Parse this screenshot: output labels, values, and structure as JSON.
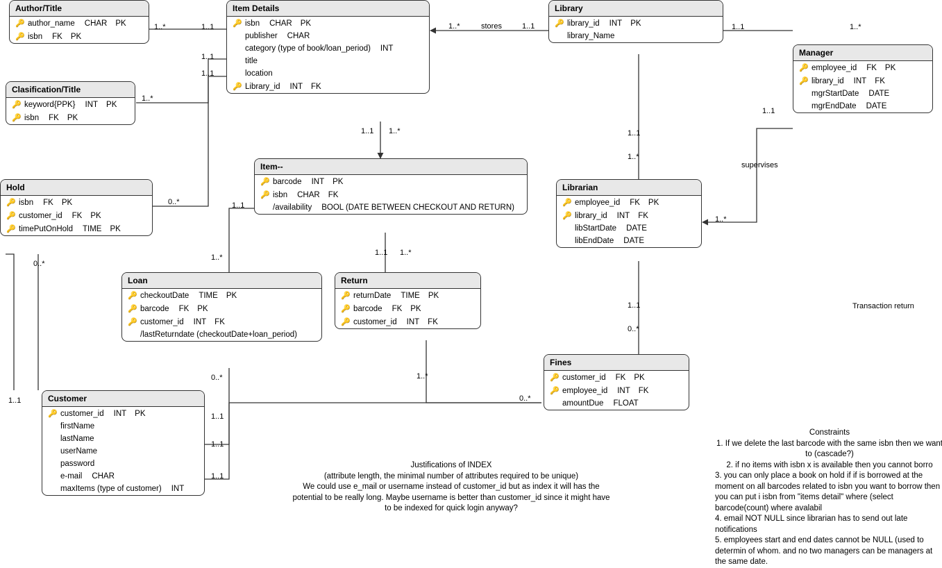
{
  "entities": {
    "authorTitle": {
      "title": "Author/Title",
      "rows": [
        {
          "key": "yellow",
          "name": "author_name",
          "type": "CHAR",
          "keys": "PK"
        },
        {
          "key": "yellow",
          "name": "isbn",
          "type": "FK",
          "keys": "PK"
        }
      ]
    },
    "classificationTitle": {
      "title": "Clasification/Title",
      "rows": [
        {
          "key": "yellow",
          "name": "keyword{PPK}",
          "type": "INT",
          "keys": "PK"
        },
        {
          "key": "yellow",
          "name": "isbn",
          "type": "FK",
          "keys": "PK"
        }
      ]
    },
    "itemDetails": {
      "title": "Item Details",
      "rows": [
        {
          "key": "yellow",
          "name": "isbn",
          "type": "CHAR",
          "keys": "PK"
        },
        {
          "key": "none",
          "name": "publisher",
          "type": "CHAR",
          "keys": ""
        },
        {
          "key": "none",
          "name": "category (type of book/loan_period)",
          "type": "INT",
          "keys": ""
        },
        {
          "key": "none",
          "name": "title",
          "type": "",
          "keys": ""
        },
        {
          "key": "none",
          "name": "location",
          "type": "",
          "keys": ""
        },
        {
          "key": "gray",
          "name": "Library_id",
          "type": "INT",
          "keys": "FK"
        }
      ]
    },
    "library": {
      "title": "Library",
      "rows": [
        {
          "key": "yellow",
          "name": "library_id",
          "type": "INT",
          "keys": "PK"
        },
        {
          "key": "none",
          "name": "library_Name",
          "type": "",
          "keys": ""
        }
      ]
    },
    "manager": {
      "title": "Manager",
      "rows": [
        {
          "key": "yellow",
          "name": "employee_id",
          "type": "FK",
          "keys": "PK"
        },
        {
          "key": "gray",
          "name": "library_id",
          "type": "INT",
          "keys": "FK"
        },
        {
          "key": "none",
          "name": "mgrStartDate",
          "type": "DATE",
          "keys": ""
        },
        {
          "key": "none",
          "name": "mgrEndDate",
          "type": "DATE",
          "keys": ""
        }
      ]
    },
    "hold": {
      "title": "Hold",
      "rows": [
        {
          "key": "yellow",
          "name": "isbn",
          "type": "FK",
          "keys": "PK"
        },
        {
          "key": "yellow",
          "name": "customer_id",
          "type": "FK",
          "keys": "PK"
        },
        {
          "key": "yellow",
          "name": "timePutOnHold",
          "type": "TIME",
          "keys": "PK"
        }
      ]
    },
    "item": {
      "title": "Item--",
      "rows": [
        {
          "key": "yellow",
          "name": "barcode",
          "type": "INT",
          "keys": "PK"
        },
        {
          "key": "gray",
          "name": "isbn",
          "type": "CHAR",
          "keys": "FK"
        },
        {
          "key": "none",
          "name": "/availability",
          "type": "BOOL (DATE BETWEEN CHECKOUT AND RETURN)",
          "keys": ""
        }
      ]
    },
    "librarian": {
      "title": "Librarian",
      "rows": [
        {
          "key": "yellow",
          "name": "employee_id",
          "type": "FK",
          "keys": "PK"
        },
        {
          "key": "gray",
          "name": "library_id",
          "type": "INT",
          "keys": "FK"
        },
        {
          "key": "none",
          "name": "libStartDate",
          "type": "DATE",
          "keys": ""
        },
        {
          "key": "none",
          "name": "libEndDate",
          "type": "DATE",
          "keys": ""
        }
      ]
    },
    "loan": {
      "title": "Loan",
      "rows": [
        {
          "key": "yellow",
          "name": "checkoutDate",
          "type": "TIME",
          "keys": "PK"
        },
        {
          "key": "yellow",
          "name": "barcode",
          "type": "FK",
          "keys": "PK"
        },
        {
          "key": "gray",
          "name": "customer_id",
          "type": "INT",
          "keys": "FK"
        },
        {
          "key": "none",
          "name": "/lastReturndate (checkoutDate+loan_period)",
          "type": "",
          "keys": ""
        }
      ]
    },
    "return": {
      "title": "Return",
      "rows": [
        {
          "key": "yellow",
          "name": "returnDate",
          "type": "TIME",
          "keys": "PK"
        },
        {
          "key": "yellow",
          "name": "barcode",
          "type": "FK",
          "keys": "PK"
        },
        {
          "key": "gray",
          "name": "customer_id",
          "type": "INT",
          "keys": "FK"
        }
      ]
    },
    "fines": {
      "title": "Fines",
      "rows": [
        {
          "key": "yellow",
          "name": "customer_id",
          "type": "FK",
          "keys": "PK"
        },
        {
          "key": "gray",
          "name": "employee_id",
          "type": "INT",
          "keys": "FK"
        },
        {
          "key": "none",
          "name": "amountDue",
          "type": "FLOAT",
          "keys": ""
        }
      ]
    },
    "customer": {
      "title": "Customer",
      "rows": [
        {
          "key": "yellow",
          "name": "customer_id",
          "type": "INT",
          "keys": "PK"
        },
        {
          "key": "none",
          "name": "firstName",
          "type": "",
          "keys": ""
        },
        {
          "key": "none",
          "name": "lastName",
          "type": "",
          "keys": ""
        },
        {
          "key": "none",
          "name": "userName",
          "type": "",
          "keys": ""
        },
        {
          "key": "none",
          "name": "password",
          "type": "",
          "keys": ""
        },
        {
          "key": "none",
          "name": "e-mail",
          "type": "CHAR",
          "keys": ""
        },
        {
          "key": "none",
          "name": "maxItems (type of customer)",
          "type": "INT",
          "keys": ""
        }
      ]
    }
  },
  "labels": {
    "stores": "stores",
    "supervises": "supervises",
    "transactionReturn": "Transaction return",
    "c01s": "0..*",
    "c11": "1..1",
    "c1s": "1..*"
  },
  "notes": {
    "indexTitle": "Justifications of INDEX",
    "indexBody": "(attribute length, the  minimal  number  of  attributes  required to be unique)\nWe could use e_mail or username instead of customer_id but as index it will has the potential to be really long. Maybe username is better than customer_id since it might have to be indexed for quick login anyway?",
    "constraintsTitle": "Constraints",
    "constraints": [
      "1. If we delete the last barcode with the same isbn then we want to (cascade?)",
      "2. if no items with isbn x is available then you cannot borro",
      "3. you can only place a book on hold if if is borrowed at the moment on all barcodes related to isbn you want to borrow then you can put i isbn from \"items detail\" where (select barcode(count) where avalabil",
      "4. email NOT NULL since librarian has to send out late notifications",
      "5. employees start and end dates cannot be NULL (used to determin of whom. and no two managers can be managers at the same date."
    ]
  }
}
